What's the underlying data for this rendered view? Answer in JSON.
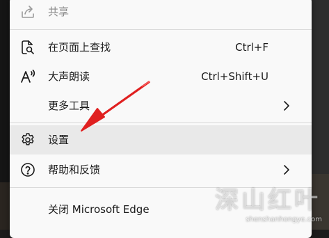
{
  "menu": {
    "items": [
      {
        "label": "共享",
        "shortcut": "",
        "icon": "share-icon",
        "disabled": true
      },
      {
        "label": "在页面上查找",
        "shortcut": "Ctrl+F",
        "icon": "find-icon"
      },
      {
        "label": "大声朗读",
        "shortcut": "Ctrl+Shift+U",
        "icon": "read-aloud-icon"
      },
      {
        "label": "更多工具",
        "shortcut": "",
        "icon": "",
        "has_submenu": true
      },
      {
        "label": "设置",
        "shortcut": "",
        "icon": "gear-icon",
        "highlighted": true
      },
      {
        "label": "帮助和反馈",
        "shortcut": "",
        "icon": "help-icon",
        "has_submenu": true
      },
      {
        "label": "关闭 Microsoft Edge",
        "shortcut": "",
        "icon": ""
      }
    ]
  },
  "watermark": {
    "title": "深山红叶",
    "url": "shenshanhongye.com"
  },
  "colors": {
    "menu_background": "#f9f9f9",
    "highlight": "#e9e9e9",
    "annotation_arrow": "#e02020"
  }
}
